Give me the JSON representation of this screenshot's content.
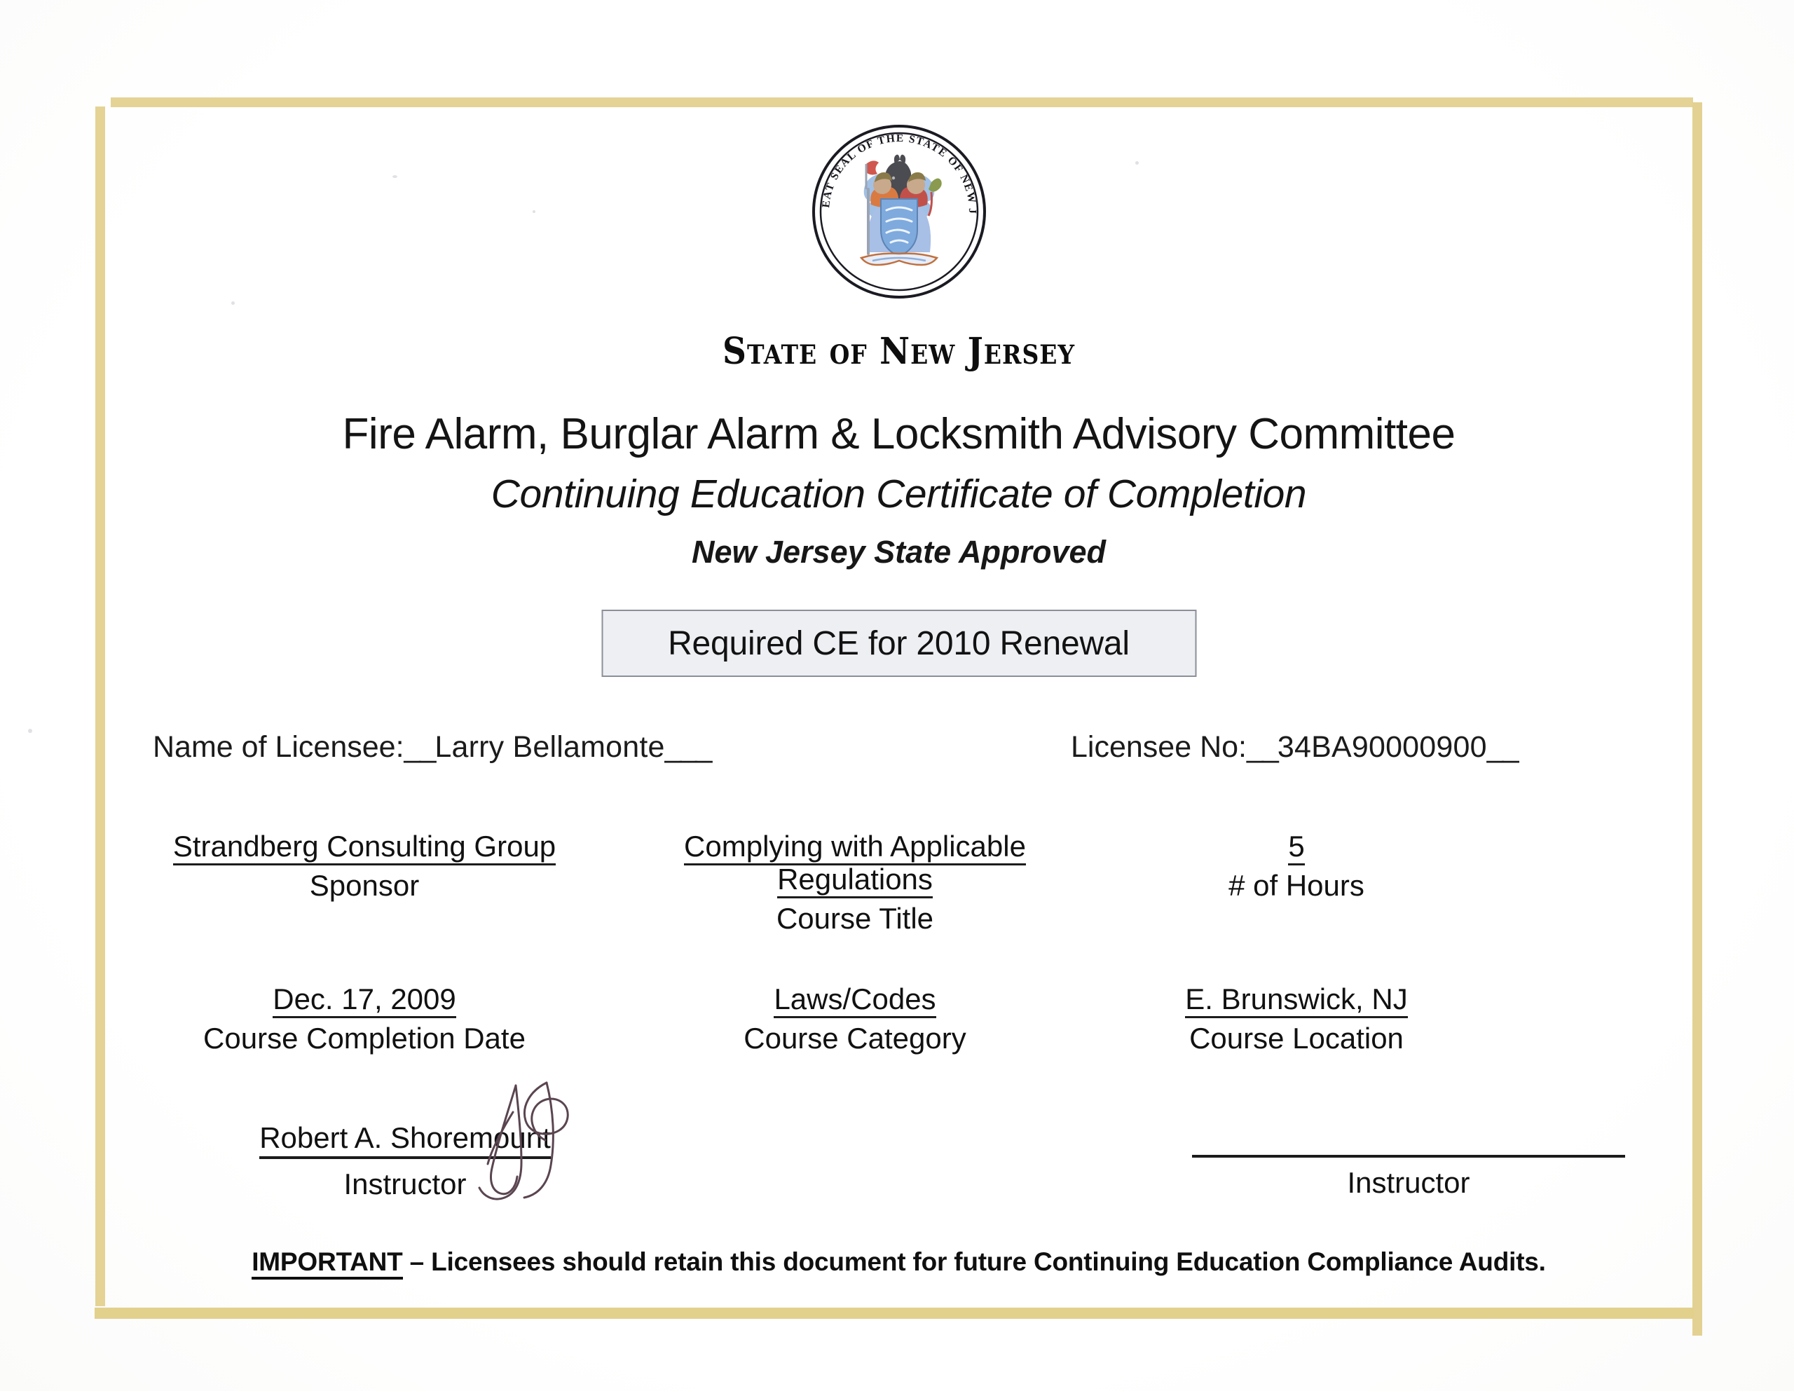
{
  "document": {
    "type": "certificate",
    "seal_icon": "new-jersey-state-seal-icon",
    "seal_legend": "THE GREAT SEAL OF THE STATE OF NEW JERSEY",
    "state_line": "State of New Jersey",
    "committee_line": "Fire Alarm, Burglar Alarm & Locksmith Advisory Committee",
    "certificate_line": "Continuing Education Certificate of Completion",
    "approved_line": "New Jersey State Approved",
    "required_ce_box": "Required CE for 2010 Renewal"
  },
  "licensee": {
    "name_label": "Name of Licensee:",
    "name_lead_blank": "__",
    "name_value": "Larry Bellamonte",
    "name_trail_blank": "___",
    "number_label": "Licensee No:",
    "number_lead_blank": "__",
    "number_value": "34BA90000900",
    "number_trail_blank": "__"
  },
  "fields": {
    "row_one": [
      {
        "value": "Strandberg Consulting Group",
        "label": "Sponsor"
      },
      {
        "value": "Complying with Applicable Regulations",
        "label": "Course Title"
      },
      {
        "value": "5",
        "label": "# of Hours"
      }
    ],
    "row_two": [
      {
        "value": "Dec. 17, 2009",
        "label": "Course Completion Date"
      },
      {
        "value": "Laws/Codes",
        "label": "Course Category"
      },
      {
        "value": "E. Brunswick, NJ",
        "label": "Course Location"
      }
    ]
  },
  "signatures": {
    "left_name": "Robert A. Shoremount",
    "left_caption": "Instructor",
    "left_signature_icon": "handwritten-signature-icon",
    "right_name": "",
    "right_caption": "Instructor"
  },
  "footer": {
    "important_word": "IMPORTANT",
    "important_text": " – Licensees should retain this document for future Continuing Education Compliance Audits."
  },
  "colors": {
    "border_gold": "#e4d395",
    "box_fill": "#edeff3",
    "box_border": "#8b8f97",
    "ink_black": "#111111",
    "signature_ink": "#5a4550",
    "seal_blue": "#7ea6d8",
    "seal_red": "#c4534a",
    "seal_orange": "#d9743f",
    "seal_olive": "#8a8040"
  }
}
